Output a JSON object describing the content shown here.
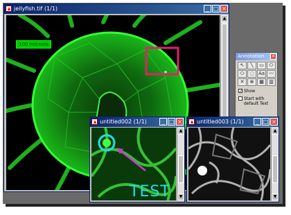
{
  "main_window": {
    "title": "jellyfish.tif (1/1)",
    "scale_label": "100 microns",
    "buttons": [
      "_",
      "□",
      "×"
    ]
  },
  "annotation_palette": {
    "title": "Annotation",
    "tools": [
      "↖",
      "╲",
      "▭",
      "⬭",
      "⬭",
      "◌",
      "Aa",
      "〰",
      "✕",
      "⊕",
      "▦",
      "▥"
    ],
    "show_label": "Show",
    "show_checked": true,
    "default_text_label": "Start with default Text",
    "default_text_checked": false
  },
  "zoom_window_1": {
    "title": "untitled002 (1/1)",
    "annotation_text": "TEST"
  },
  "zoom_window_2": {
    "title": "untitled003 (1/1)"
  },
  "colors": {
    "selection_box": "#e0216b",
    "annotation_cyan": "#22dde8",
    "annotation_arrow": "#c83cc8"
  }
}
